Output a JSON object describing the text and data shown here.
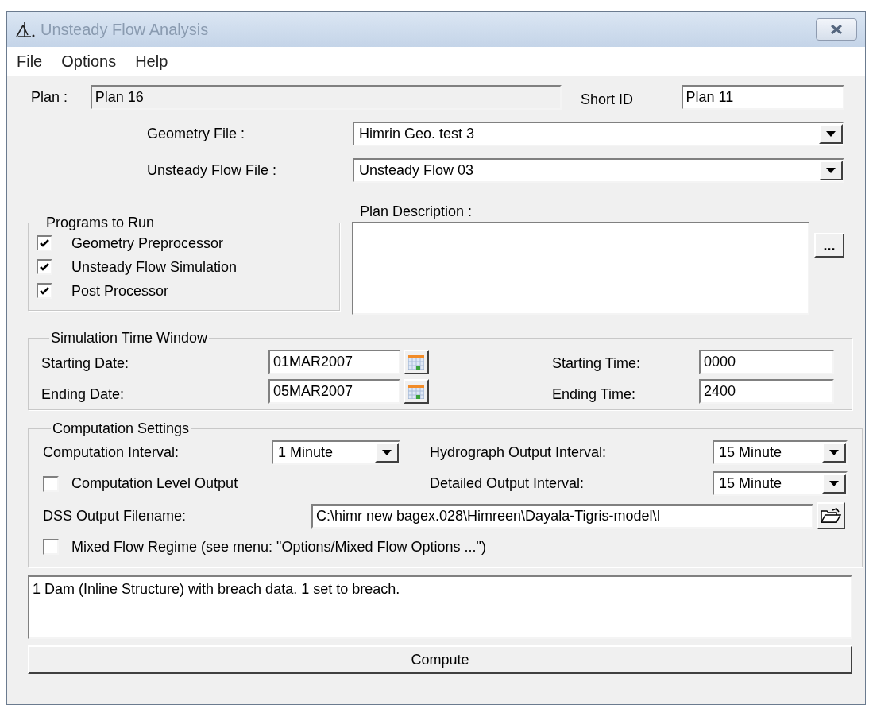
{
  "window": {
    "title": "Unsteady Flow Analysis"
  },
  "menu": [
    "File",
    "Options",
    "Help"
  ],
  "plan": {
    "label": "Plan :",
    "value": "Plan 16"
  },
  "short_id": {
    "label": "Short ID",
    "value": "Plan 11"
  },
  "geometry_file": {
    "label": "Geometry File :",
    "value": "Himrin Geo. test 3"
  },
  "unsteady_flow_file": {
    "label": "Unsteady Flow File :",
    "value": "Unsteady Flow 03"
  },
  "plan_description": {
    "label": "Plan Description :",
    "button": "..."
  },
  "programs_to_run": {
    "title": "Programs to Run",
    "items": [
      {
        "label": "Geometry Preprocessor",
        "checked": true
      },
      {
        "label": "Unsteady Flow Simulation",
        "checked": true
      },
      {
        "label": "Post Processor",
        "checked": true
      }
    ]
  },
  "simulation_time_window": {
    "title": "Simulation Time Window",
    "rows": [
      {
        "date_label": "Starting Date:",
        "date": "01MAR2007",
        "time_label": "Starting Time:",
        "time": "0000"
      },
      {
        "date_label": "Ending Date:",
        "date": "05MAR2007",
        "time_label": "Ending Time:",
        "time": "2400"
      }
    ]
  },
  "computation_settings": {
    "title": "Computation Settings",
    "computation_interval": {
      "label": "Computation Interval:",
      "value": "1 Minute"
    },
    "hydrograph_output_interval": {
      "label": "Hydrograph Output Interval:",
      "value": "15 Minute"
    },
    "detailed_output_interval": {
      "label": "Detailed Output Interval:",
      "value": "15 Minute"
    },
    "computation_level_output": {
      "label": "Computation Level Output",
      "checked": false
    },
    "dss_output_filename": {
      "label": "DSS Output Filename:",
      "value": "C:\\himr new bagex.028\\Himreen\\Dayala-Tigris-model\\I"
    },
    "mixed_flow_regime": {
      "label": "Mixed Flow Regime (see menu: \"Options/Mixed Flow Options ...\")",
      "checked": false
    }
  },
  "message": "1 Dam (Inline Structure) with breach data. 1 set to breach.",
  "compute_button": "Compute"
}
